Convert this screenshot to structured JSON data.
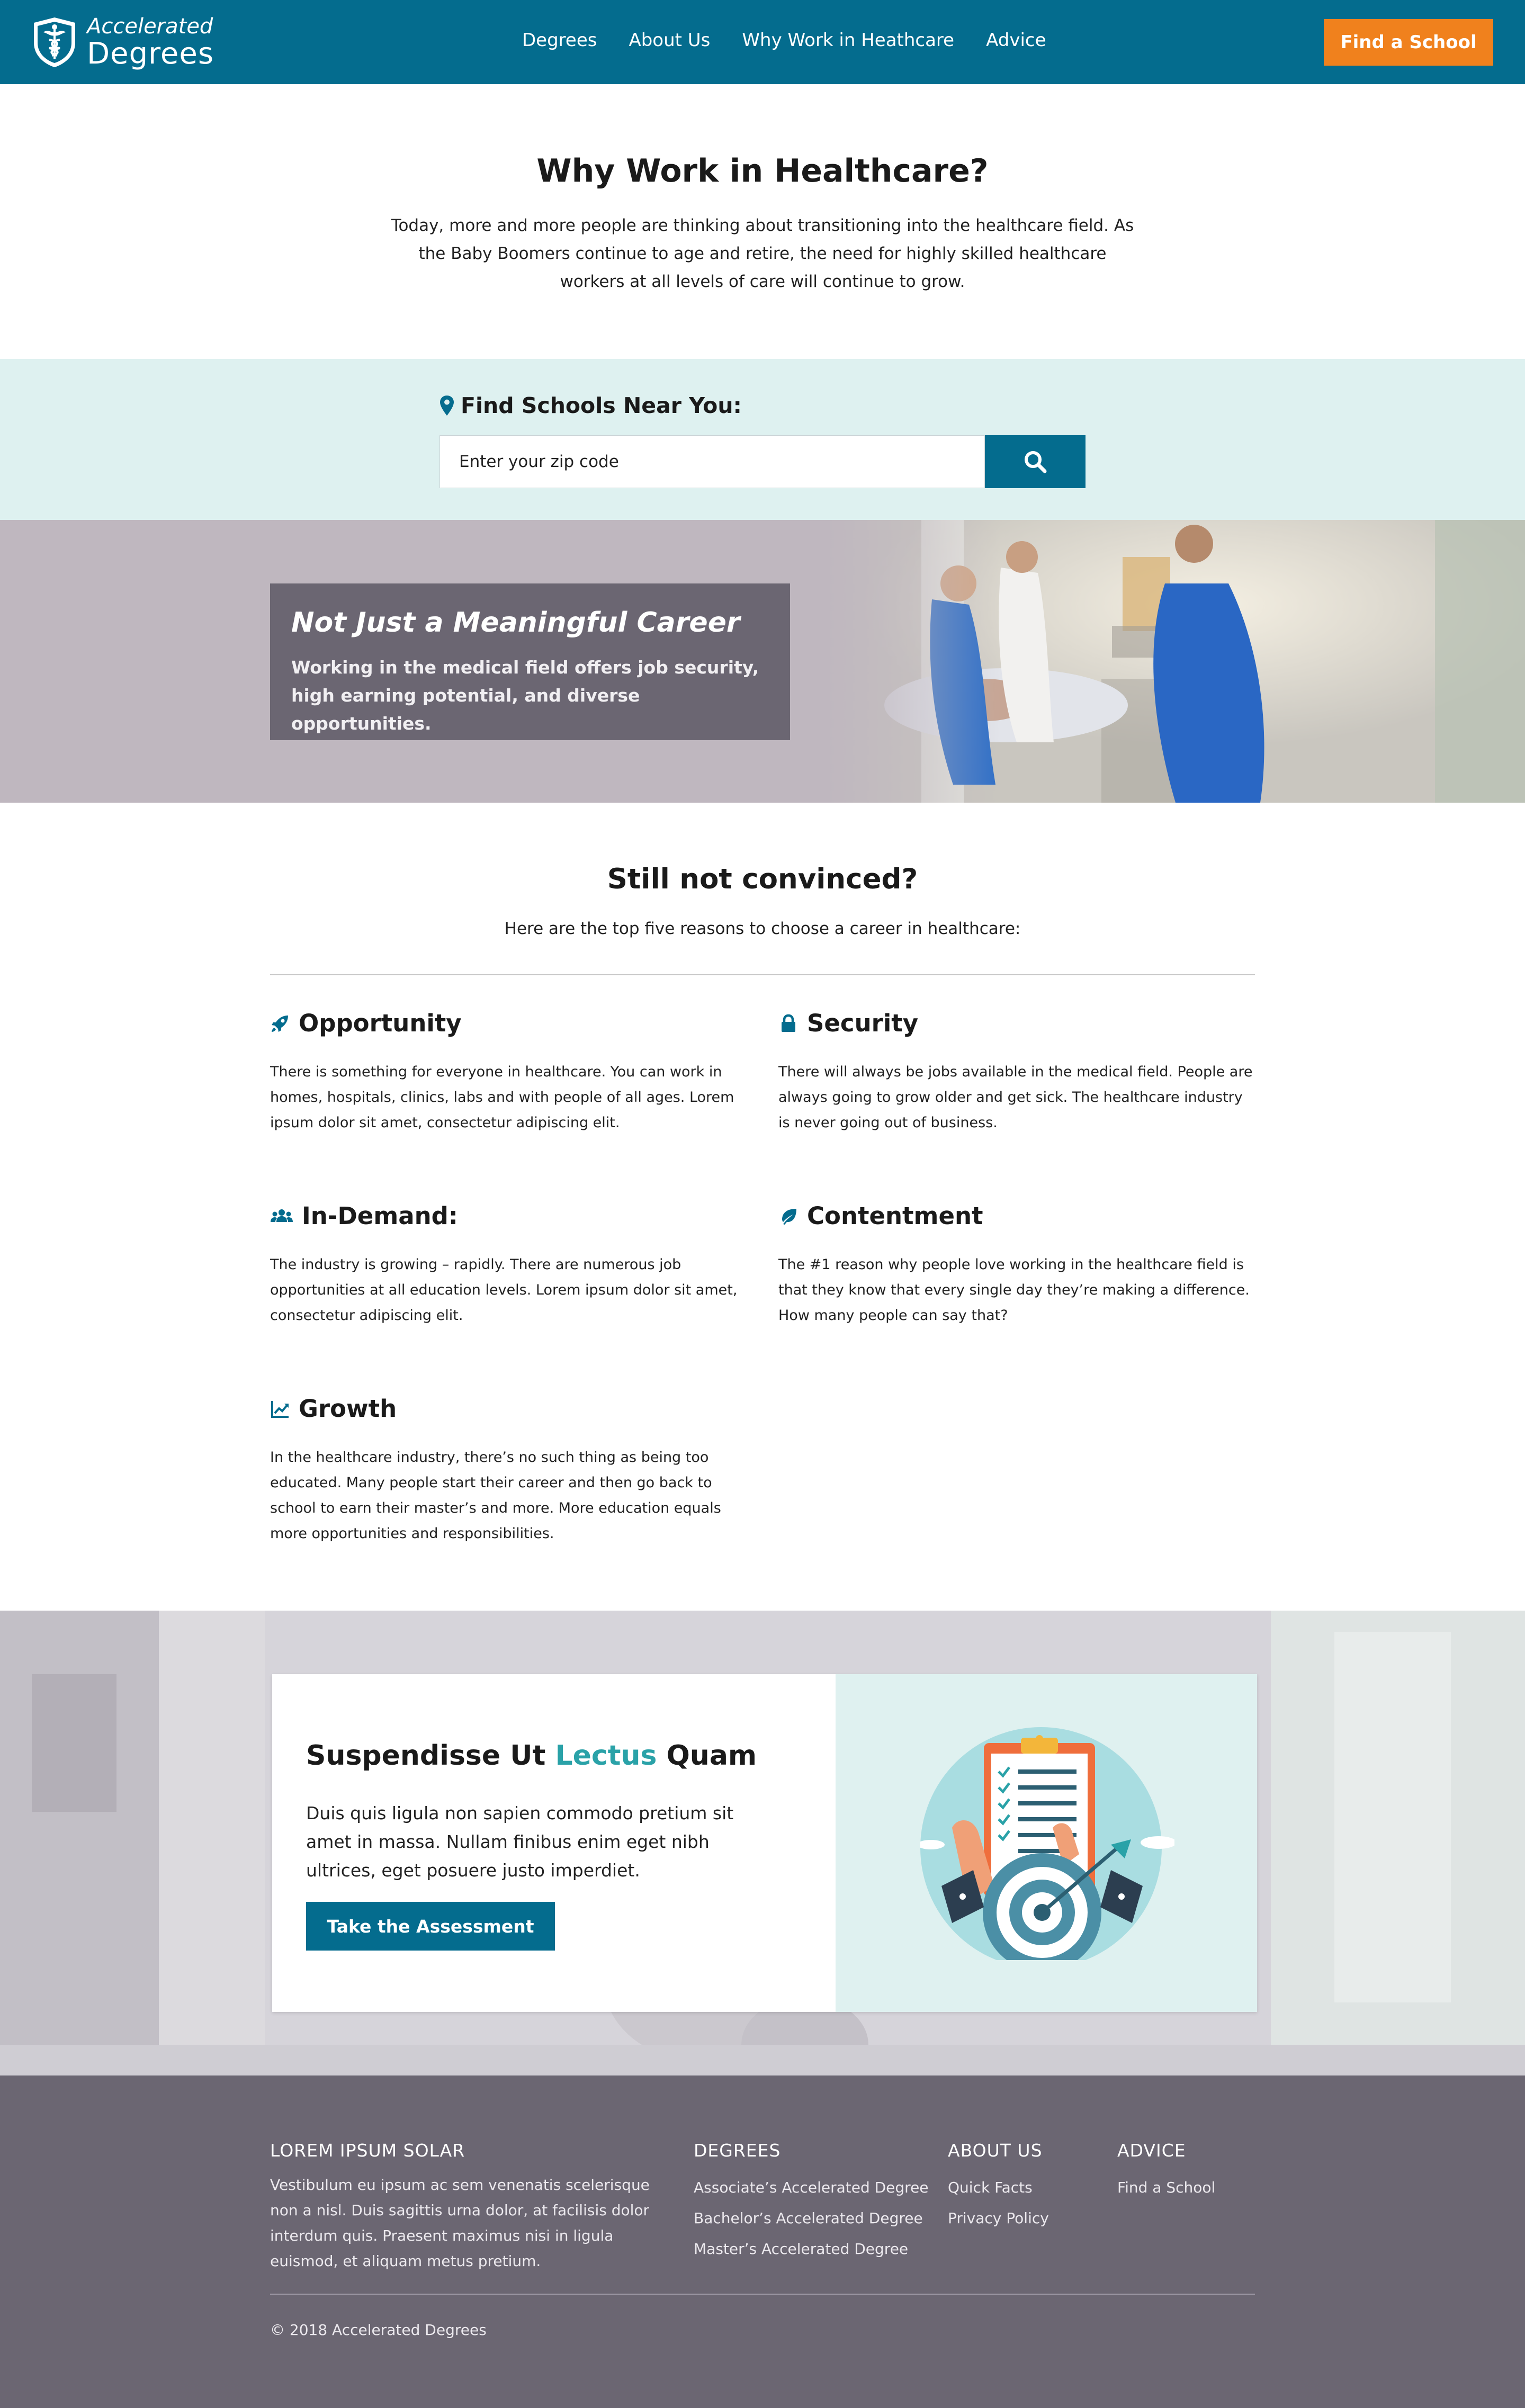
{
  "header": {
    "logo_line1": "Accelerated",
    "logo_line2": "Degrees",
    "nav": [
      "Degrees",
      "About Us",
      "Why Work in Heathcare",
      "Advice"
    ],
    "cta_label": "Find a School"
  },
  "intro": {
    "title": "Why Work in Healthcare?",
    "text": "Today, more and more people are thinking about transitioning into the healthcare field. As the Baby Boomers continue to age and retire, the need for highly skilled healthcare workers at all levels of care will continue to grow."
  },
  "search": {
    "label": "Find Schools Near You:",
    "placeholder": "Enter your zip code",
    "icon": "search-icon"
  },
  "hero": {
    "title": "Not Just a Meaningful Career",
    "text_before": "Working in the medical field offers ",
    "bold1": "job security, high earning potential",
    "text_mid": ", and ",
    "bold2": "diverse opportunities."
  },
  "reasons": {
    "title": "Still not convinced?",
    "subtitle": "Here are the top five reasons to choose a career in healthcare:",
    "items": [
      {
        "title": "Opportunity",
        "icon": "rocket-icon",
        "text": "There is something for everyone in healthcare. You can work in homes, hospitals, clinics, labs and with people of all ages. Lorem ipsum dolor sit amet, consectetur adipiscing elit."
      },
      {
        "title": "Security",
        "icon": "lock-icon",
        "text": "There will always be jobs available in the medical field. People are always going to grow older and get sick. The healthcare industry is never going out of business."
      },
      {
        "title": "In-Demand:",
        "icon": "users-icon",
        "text": "The industry is growing – rapidly. There are numerous job opportunities at all education levels. Lorem ipsum dolor sit amet, consectetur adipiscing elit."
      },
      {
        "title": "Contentment",
        "icon": "leaf-icon",
        "text": "The #1 reason why people love working in the healthcare field is that they know that every single day they’re making a difference. How many people can say that?"
      },
      {
        "title": "Growth",
        "icon": "chart-line-icon",
        "text": "In the healthcare industry, there’s no such thing as being too educated. Many people start their career and then go back to school to earn their master’s and more. More education equals more opportunities and responsibilities."
      }
    ]
  },
  "assessment": {
    "title_part1": "Suspendisse Ut ",
    "title_accent": "Lectus",
    "title_part2": " Quam",
    "text": "Duis quis ligula non sapien commodo pretium sit amet in massa. Nullam finibus enim eget nibh ultrices, eget posuere justo imperdiet.",
    "button": "Take the Assessment",
    "accent_color": "#2aa2a8"
  },
  "footer": {
    "about_heading": "LOREM IPSUM SOLAR",
    "about_text": "Vestibulum eu ipsum ac sem venenatis scelerisque non a nisl. Duis sagittis urna dolor, at facilisis dolor interdum quis. Praesent maximus nisi in ligula euismod, et aliquam metus pretium.",
    "degrees_heading": "DEGREES",
    "degrees_links": [
      "Associate’s Accelerated Degree",
      "Bachelor’s Accelerated Degree",
      "Master’s Accelerated Degree"
    ],
    "aboutus_heading": "ABOUT US",
    "aboutus_links": [
      "Quick Facts",
      "Privacy Policy"
    ],
    "advice_heading": "ADVICE",
    "advice_links": [
      "Find a School"
    ],
    "copyright": "© 2018 Accelerated Degrees"
  },
  "colors": {
    "primary": "#046c8e",
    "cta": "#f0811d",
    "search_band": "#def1f0",
    "footer": "#6b6672"
  }
}
